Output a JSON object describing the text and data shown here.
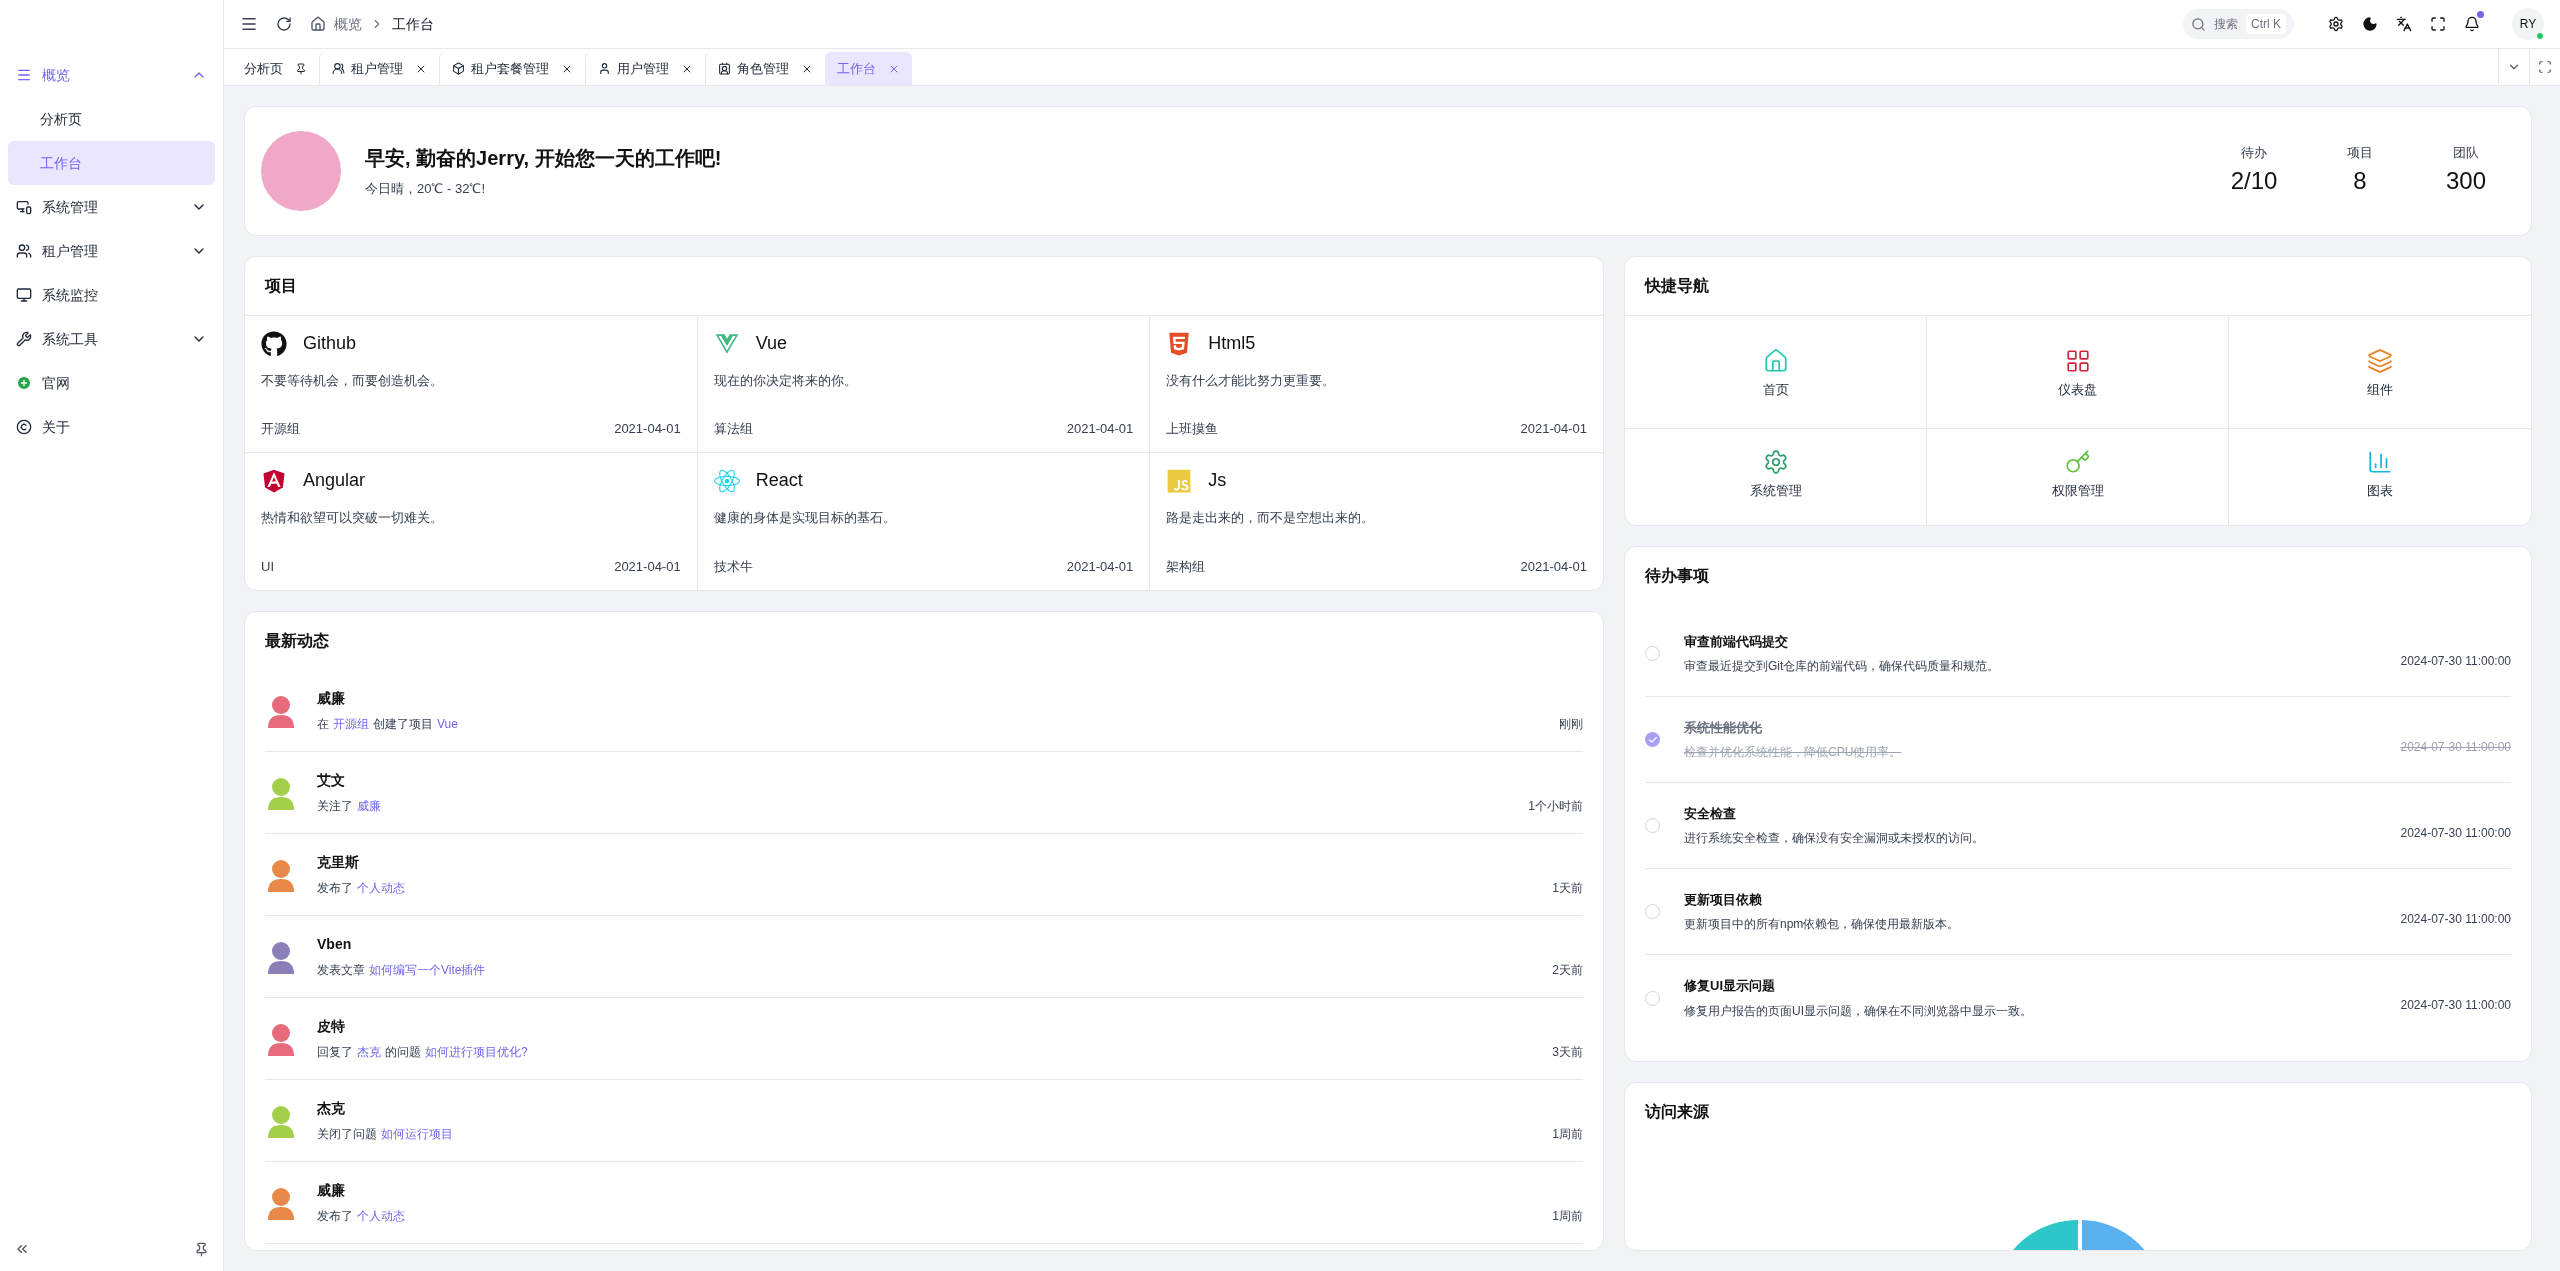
{
  "sidebar": {
    "items": [
      {
        "label": "概览",
        "expanded": true,
        "selected": false,
        "children": [
          {
            "label": "分析页",
            "selected": false
          },
          {
            "label": "工作台",
            "selected": true
          }
        ]
      },
      {
        "label": "系统管理",
        "expanded": false,
        "selected": false
      },
      {
        "label": "租户管理",
        "expanded": false,
        "selected": false
      },
      {
        "label": "系统监控",
        "selected": false
      },
      {
        "label": "系统工具",
        "expanded": false,
        "selected": false
      },
      {
        "label": "官网",
        "selected": false
      },
      {
        "label": "关于",
        "selected": false
      }
    ]
  },
  "header": {
    "breadcrumb": [
      "概览",
      "工作台"
    ],
    "search": {
      "placeholder": "搜索",
      "shortcut": "Ctrl K"
    },
    "notification_dot": true,
    "user_avatar": "RY",
    "online": true
  },
  "tabs": [
    {
      "label": "分析页",
      "pinned": true,
      "selected": false
    },
    {
      "label": "租户管理",
      "pinned": false,
      "selected": false
    },
    {
      "label": "租户套餐管理",
      "pinned": false,
      "selected": false
    },
    {
      "label": "用户管理",
      "pinned": false,
      "selected": false
    },
    {
      "label": "角色管理",
      "pinned": false,
      "selected": false
    },
    {
      "label": "工作台",
      "pinned": false,
      "selected": true
    }
  ],
  "welcome": {
    "greeting": "早安, 勤奋的Jerry, 开始您一天的工作吧!",
    "weather": "今日晴，20℃ - 32℃!",
    "stats": [
      {
        "label": "待办",
        "value": "2/10"
      },
      {
        "label": "项目",
        "value": "8"
      },
      {
        "label": "团队",
        "value": "300"
      }
    ]
  },
  "projects": {
    "title": "项目",
    "items": [
      {
        "name": "Github",
        "description": "不要等待机会，而要创造机会。",
        "group": "开源组",
        "date": "2021-04-01"
      },
      {
        "name": "Vue",
        "description": "现在的你决定将来的你。",
        "group": "算法组",
        "date": "2021-04-01"
      },
      {
        "name": "Html5",
        "description": "没有什么才能比努力更重要。",
        "group": "上班摸鱼",
        "date": "2021-04-01"
      },
      {
        "name": "Angular",
        "description": "热情和欲望可以突破一切难关。",
        "group": "UI",
        "date": "2021-04-01"
      },
      {
        "name": "React",
        "description": "健康的身体是实现目标的基石。",
        "group": "技术牛",
        "date": "2021-04-01"
      },
      {
        "name": "Js",
        "description": "路是走出来的，而不是空想出来的。",
        "group": "架构组",
        "date": "2021-04-01"
      }
    ]
  },
  "activity": {
    "title": "最新动态",
    "items": [
      {
        "name": "威廉",
        "parts": [
          {
            "kind": "text",
            "text": "在"
          },
          {
            "kind": "link",
            "text": "开源组"
          },
          {
            "kind": "text",
            "text": "创建了项目"
          },
          {
            "kind": "link",
            "text": "Vue"
          }
        ],
        "time": "刚刚",
        "color": "#e86a7d"
      },
      {
        "name": "艾文",
        "parts": [
          {
            "kind": "text",
            "text": "关注了"
          },
          {
            "kind": "link",
            "text": "威廉"
          }
        ],
        "time": "1个小时前",
        "color": "#a3cf4a"
      },
      {
        "name": "克里斯",
        "parts": [
          {
            "kind": "text",
            "text": "发布了"
          },
          {
            "kind": "link",
            "text": "个人动态"
          }
        ],
        "time": "1天前",
        "color": "#e8894a"
      },
      {
        "name": "Vben",
        "parts": [
          {
            "kind": "text",
            "text": "发表文章"
          },
          {
            "kind": "link",
            "text": "如何编写一个Vite插件"
          }
        ],
        "time": "2天前",
        "color": "#8b7fb8"
      },
      {
        "name": "皮特",
        "parts": [
          {
            "kind": "text",
            "text": "回复了"
          },
          {
            "kind": "link",
            "text": "杰克"
          },
          {
            "kind": "text",
            "text": "的问题"
          },
          {
            "kind": "link",
            "text": "如何进行项目优化?"
          }
        ],
        "time": "3天前",
        "color": "#e86a7d"
      },
      {
        "name": "杰克",
        "parts": [
          {
            "kind": "text",
            "text": "关闭了问题"
          },
          {
            "kind": "link",
            "text": "如何运行项目"
          }
        ],
        "time": "1周前",
        "color": "#a3cf4a"
      },
      {
        "name": "威廉",
        "parts": [
          {
            "kind": "text",
            "text": "发布了"
          },
          {
            "kind": "link",
            "text": "个人动态"
          }
        ],
        "time": "1周前",
        "color": "#e8894a"
      }
    ]
  },
  "quick_nav": {
    "title": "快捷导航",
    "items": [
      {
        "label": "首页",
        "color": "#1fc8b0"
      },
      {
        "label": "仪表盘",
        "color": "#d0243f"
      },
      {
        "label": "组件",
        "color": "#e5811f"
      },
      {
        "label": "系统管理",
        "color": "#28a06a"
      },
      {
        "label": "权限管理",
        "color": "#5fbf3a"
      },
      {
        "label": "图表",
        "color": "#12b5e3"
      }
    ]
  },
  "todo": {
    "title": "待办事项",
    "items": [
      {
        "title": "审查前端代码提交",
        "description": "审查最近提交到Git仓库的前端代码，确保代码质量和规范。",
        "date": "2024-07-30 11:00:00",
        "checked": false
      },
      {
        "title": "系统性能优化",
        "description": "检查并优化系统性能，降低CPU使用率。",
        "date": "2024-07-30 11:00:00",
        "checked": true
      },
      {
        "title": "安全检查",
        "description": "进行系统安全检查，确保没有安全漏洞或未授权的访问。",
        "date": "2024-07-30 11:00:00",
        "checked": false
      },
      {
        "title": "更新项目依赖",
        "description": "更新项目中的所有npm依赖包，确保使用最新版本。",
        "date": "2024-07-30 11:00:00",
        "checked": false
      },
      {
        "title": "修复UI显示问题",
        "description": "修复用户报告的页面UI显示问题，确保在不同浏览器中显示一致。",
        "date": "2024-07-30 11:00:00",
        "checked": false
      }
    ]
  },
  "visits": {
    "title": "访问来源"
  }
}
